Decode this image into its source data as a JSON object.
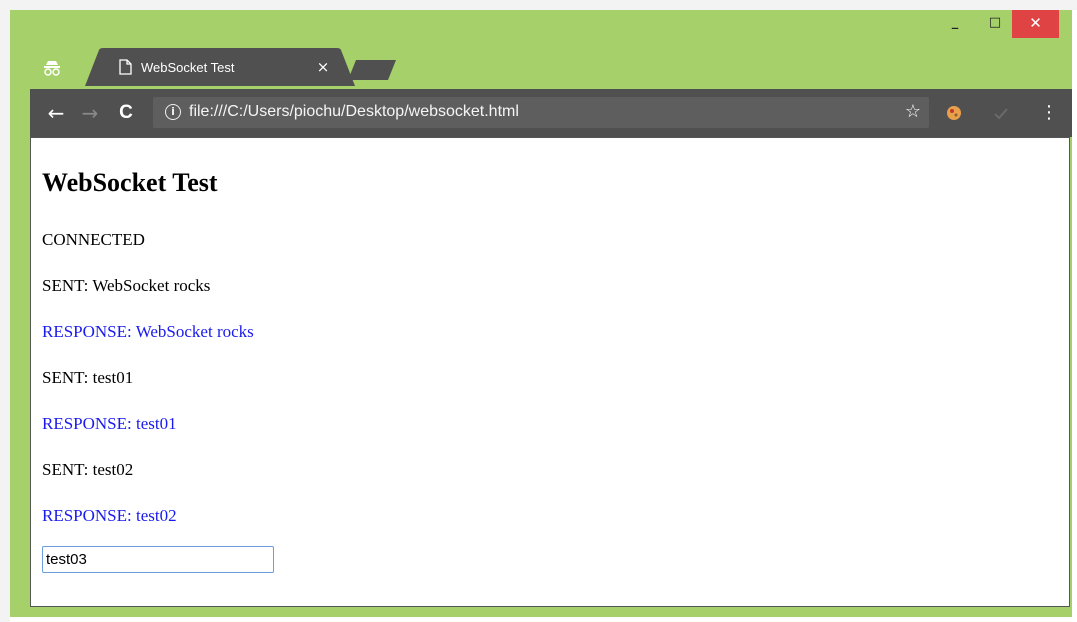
{
  "browser": {
    "tab_title": "WebSocket Test",
    "tab_close": "×",
    "url": "file:///C:/Users/piochu/Desktop/websocket.html",
    "window_controls": {
      "minimize": "_",
      "maximize": "□",
      "close": "✕"
    },
    "nav": {
      "back": "←",
      "forward": "→",
      "reload": "C"
    },
    "info_glyph": "i",
    "star_glyph": "☆",
    "menu_glyph": "⋮",
    "icons": [
      "incognito-icon",
      "page-icon",
      "info-icon",
      "star-icon",
      "extension-icon",
      "menu-icon"
    ],
    "colors": {
      "frame": "#a6d06a",
      "toolbar": "#505050",
      "close_button": "#e04343"
    }
  },
  "page": {
    "heading": "WebSocket Test",
    "log": [
      {
        "text": "CONNECTED",
        "type": "status"
      },
      {
        "text": "SENT: WebSocket rocks",
        "type": "sent"
      },
      {
        "text": "RESPONSE: WebSocket rocks",
        "type": "response"
      },
      {
        "text": "SENT: test01",
        "type": "sent"
      },
      {
        "text": "RESPONSE: test01",
        "type": "response"
      },
      {
        "text": "SENT: test02",
        "type": "sent"
      },
      {
        "text": "RESPONSE: test02",
        "type": "response"
      }
    ],
    "input_value": "test03",
    "colors": {
      "response": "#1a1aee",
      "text": "#000000"
    }
  }
}
